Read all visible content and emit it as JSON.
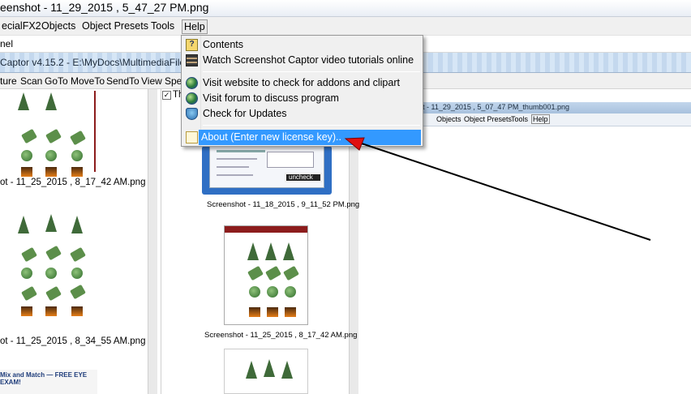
{
  "window": {
    "title": "eenshot - 11_29_2015 , 5_47_27 PM.png"
  },
  "menubar": {
    "items": [
      "ecialFX2",
      "Objects",
      "Object Presets",
      "Tools",
      "Help"
    ]
  },
  "panel_strip": {
    "label": "nel"
  },
  "inner_window": {
    "title": "Captor v4.15.2 - E:\\MyDocs\\MultimediaFiles\\Screen",
    "menu": [
      "ture",
      "Scan",
      "GoTo",
      "MoveTo",
      "SendTo",
      "View",
      "Spec"
    ],
    "view_checkbox_label": "Th"
  },
  "thumbnails": {
    "left_caption_1": "ot - 11_25_2015 , 8_17_42 AM.png",
    "left_caption_2": "ot - 11_25_2015 , 8_34_55 AM.png",
    "mid_caption_1": "Screenshot - 11_18_2015 , 9_11_52 PM.png",
    "mid_caption_2": "Screenshot - 11_25_2015 , 8_17_42 AM.png",
    "blue_thumb_label": "uncheck",
    "left_promo": "Mix and Match — FREE EYE EXAM!"
  },
  "nested_window": {
    "title": "ot - 11_29_2015 , 5_07_47 PM_thumb001.png",
    "menu": [
      "Objects",
      "Object Presets",
      "Tools",
      "Help"
    ]
  },
  "help_menu": {
    "items": [
      {
        "label": "Contents",
        "icon": "help-book-icon"
      },
      {
        "label": "Watch Screenshot Captor video tutorials online",
        "icon": "film-icon"
      },
      {
        "label": "Visit website to check for addons and clipart",
        "icon": "globe-icon"
      },
      {
        "label": "Visit forum to discuss program",
        "icon": "globe-icon"
      },
      {
        "label": "Check for Updates",
        "icon": "shield-update-icon"
      },
      {
        "label": "About (Enter new license key)..",
        "icon": "about-icon",
        "highlighted": true
      }
    ]
  },
  "annotation": {
    "arrow_color": "#000000",
    "arrowhead_color": "#e01010"
  }
}
